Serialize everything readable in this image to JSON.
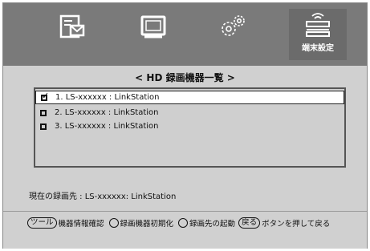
{
  "tabs": [
    {
      "icon": "status-icon",
      "label": ""
    },
    {
      "icon": "screen-icon",
      "label": ""
    },
    {
      "icon": "gear-icon",
      "label": ""
    },
    {
      "icon": "network-device-icon",
      "label": "端末設定"
    }
  ],
  "heading": "< HD 録画機器一覧 >",
  "devices": [
    {
      "text": "1. LS-xxxxxx : LinkStation",
      "checked": true
    },
    {
      "text": "2. LS-xxxxxx : LinkStation",
      "checked": false
    },
    {
      "text": "3. LS-xxxxxx : LinkStation",
      "checked": false
    }
  ],
  "current_label": "現在の録画先 : LS-xxxxxx: LinkStation",
  "footer": {
    "tool_key": "ツール",
    "tool_action": "機器情報確認",
    "circle1_action": "録画機器初期化",
    "circle2_action": "録画先の起動",
    "back_key": "戻る",
    "back_action": "ボタンを押して戻る"
  }
}
